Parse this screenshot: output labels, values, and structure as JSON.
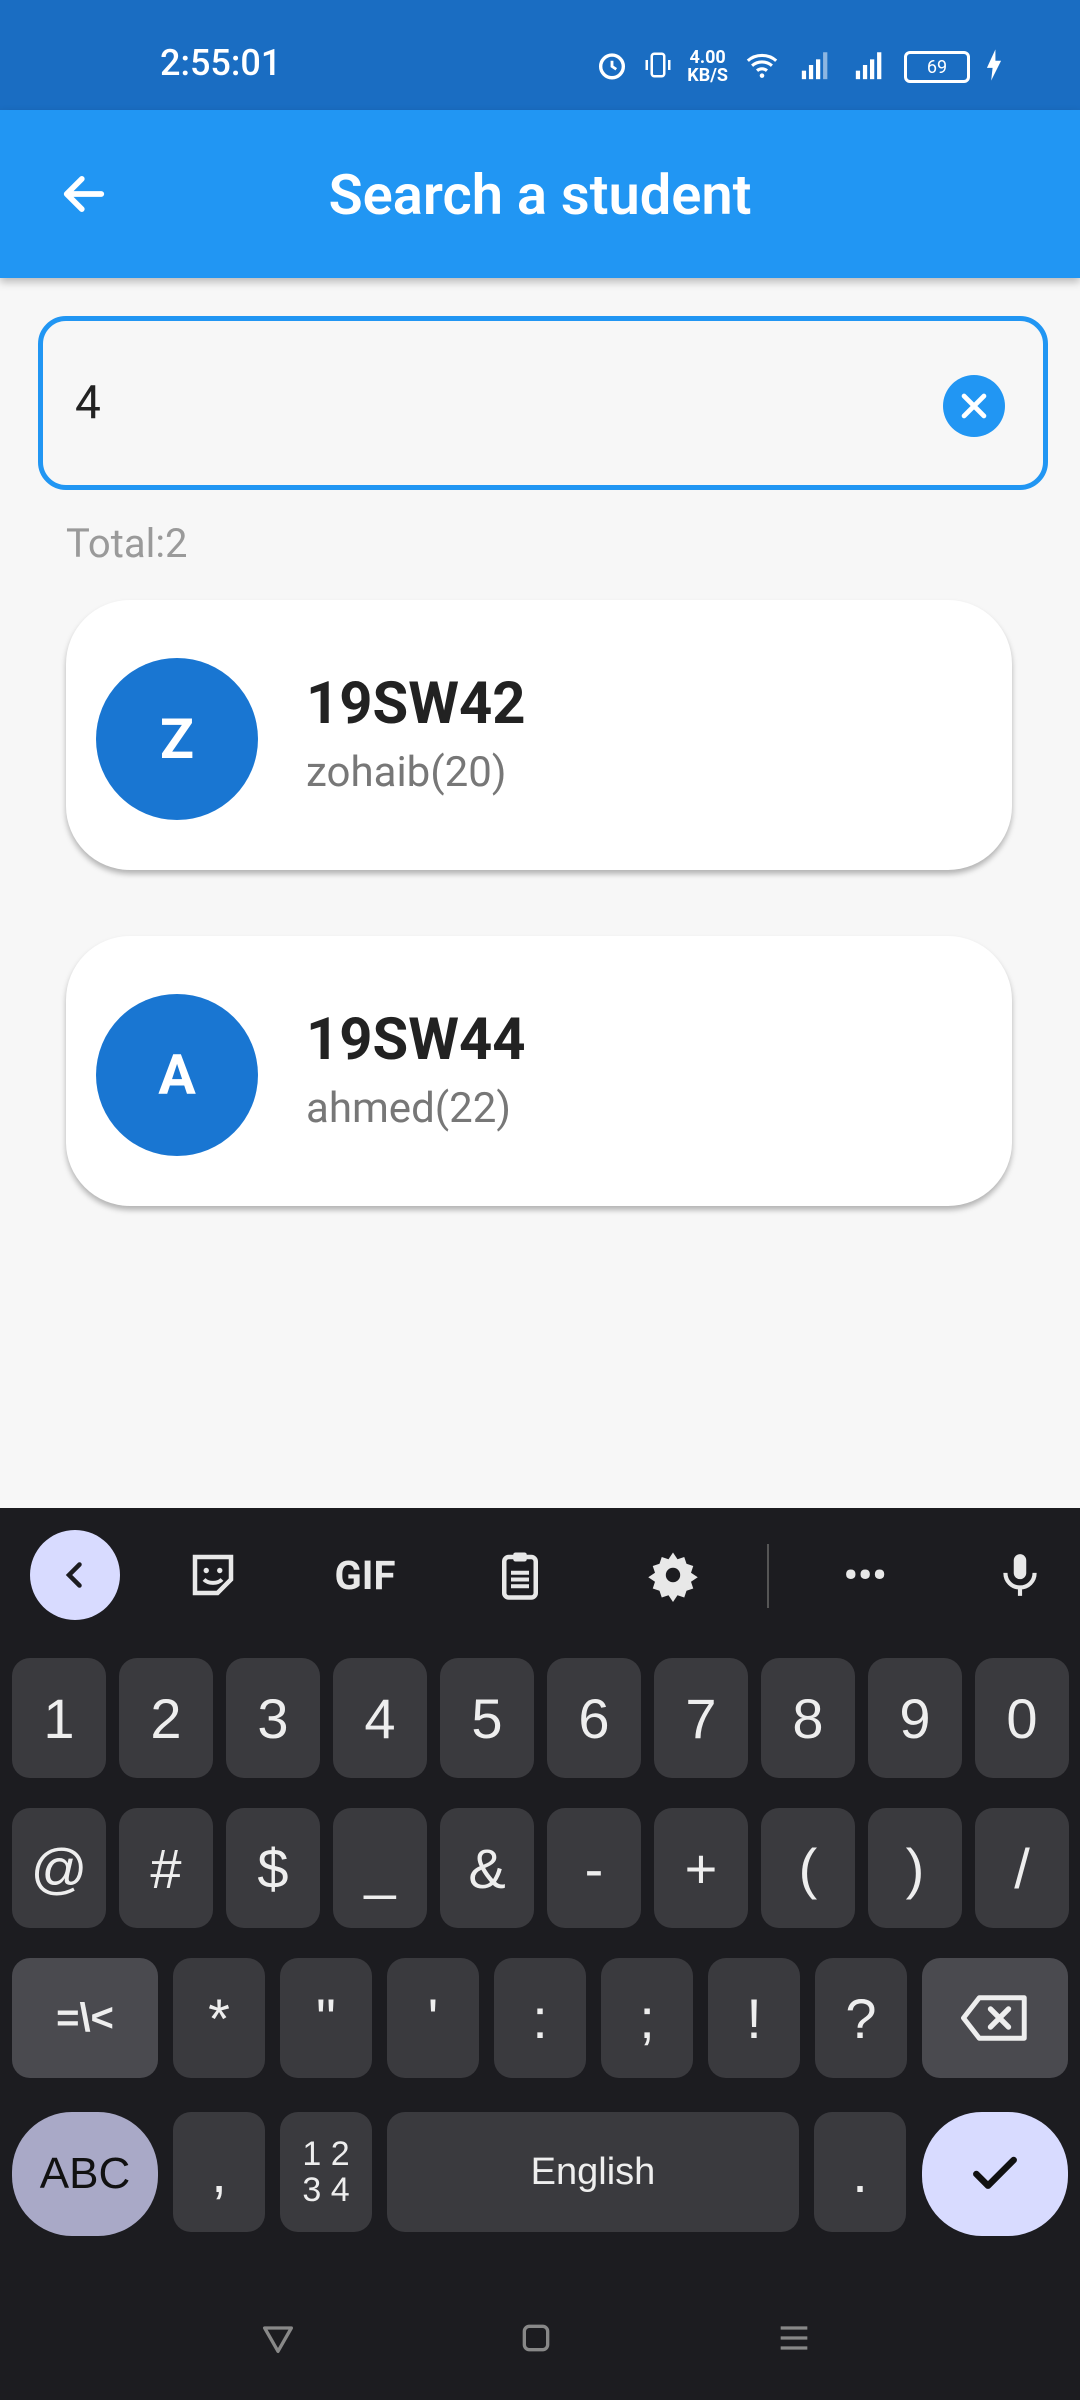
{
  "status_bar": {
    "time": "2:55:01",
    "net_speed_value": "4.00",
    "net_speed_unit": "KB/S",
    "battery_level": "69"
  },
  "app_bar": {
    "title": "Search a student"
  },
  "search": {
    "value": "4"
  },
  "results": {
    "total_label": "Total:2",
    "students": [
      {
        "initial": "Z",
        "code": "19SW42",
        "name": "zohaib(20)"
      },
      {
        "initial": "A",
        "code": "19SW44",
        "name": "ahmed(22)"
      }
    ]
  },
  "keyboard": {
    "toolbar": {
      "gif": "GIF",
      "more": "•••"
    },
    "row1": [
      "1",
      "2",
      "3",
      "4",
      "5",
      "6",
      "7",
      "8",
      "9",
      "0"
    ],
    "row2": [
      "@",
      "#",
      "$",
      "_",
      "&",
      "-",
      "+",
      "(",
      ")",
      "/"
    ],
    "row3": [
      "=\\<",
      "*",
      "\"",
      "'",
      ":",
      ";",
      "!",
      "?"
    ],
    "abc": "ABC",
    "comma": ",",
    "numbers": "1 2\n3 4",
    "space": "English",
    "period": "."
  },
  "colors": {
    "status_bar": "#1a6dc2",
    "app_bar": "#2196f3",
    "avatar": "#1976d2",
    "keyboard_bg": "#1c1c20"
  }
}
